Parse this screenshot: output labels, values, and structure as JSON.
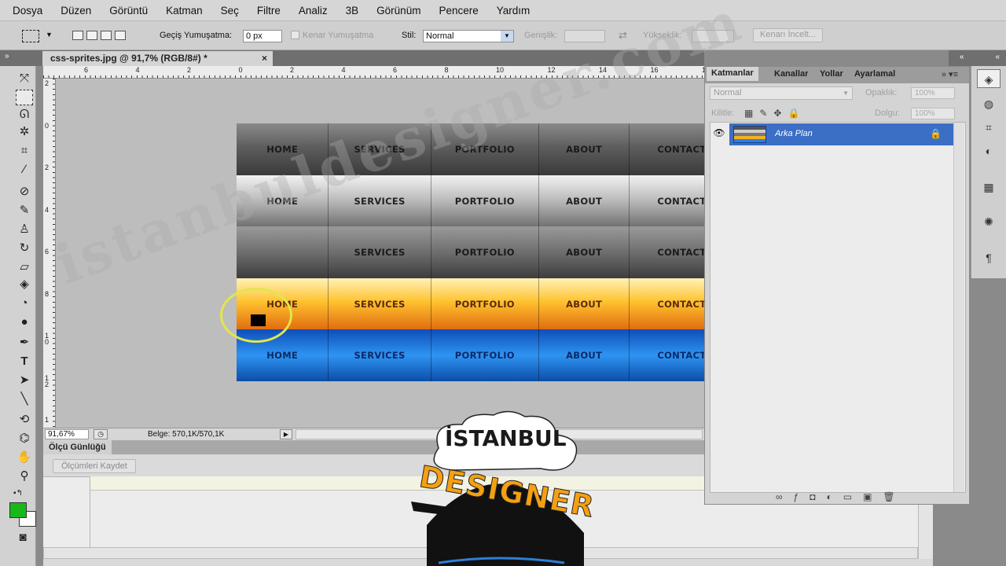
{
  "menu": [
    "Dosya",
    "Düzen",
    "Görüntü",
    "Katman",
    "Seç",
    "Filtre",
    "Analiz",
    "3B",
    "Görünüm",
    "Pencere",
    "Yardım"
  ],
  "options": {
    "feather_label": "Geçiş Yumuşatma:",
    "feather_value": "0 px",
    "antialias_label": "Kenar Yumuşatma",
    "style_label": "Stil:",
    "style_value": "Normal",
    "width_label": "Genişlik:",
    "height_label": "Yükseklik:",
    "refine_label": "Kenarı İncelt..."
  },
  "document_tab": {
    "title": "css-sprites.jpg @ 91,7% (RGB/8#) *",
    "close": "×"
  },
  "ruler_h_labels": [
    "6",
    "4",
    "2",
    "0",
    "2",
    "4",
    "6",
    "8",
    "10",
    "12",
    "14",
    "16",
    "1"
  ],
  "ruler_v_labels": [
    "2",
    "0",
    "2",
    "4",
    "6",
    "8",
    "1\n0",
    "1\n2",
    "1"
  ],
  "sprite_rows": [
    [
      "HOME",
      "SERVICES",
      "PORTFOLIO",
      "ABOUT",
      "CONTACT"
    ],
    [
      "HOME",
      "SERVICES",
      "PORTFOLIO",
      "ABOUT",
      "CONTACT"
    ],
    [
      "",
      "SERVICES",
      "PORTFOLIO",
      "ABOUT",
      "CONTACT"
    ],
    [
      "HOME",
      "SERVICES",
      "PORTFOLIO",
      "ABOUT",
      "CONTACT"
    ],
    [
      "HOME",
      "SERVICES",
      "PORTFOLIO",
      "ABOUT",
      "CONTACT"
    ]
  ],
  "status": {
    "zoom": "91,67%",
    "doc_info": "Belge: 570,1K/570,1K"
  },
  "measurement_log": {
    "tab_label": "Ölçü Günlüğü",
    "record_button": "Ölçümleri Kaydet"
  },
  "layers_panel": {
    "tabs": [
      "Katmanlar",
      "Kanallar",
      "Yollar",
      "Ayarlamal"
    ],
    "blend_mode": "Normal",
    "opacity_label": "Opaklık:",
    "opacity_value": "100%",
    "lock_label": "Kilitle:",
    "fill_label": "Dolgu:",
    "fill_value": "100%",
    "layer_name": "Arka Plan"
  },
  "colors": {
    "foreground": "#18b818",
    "background": "#ffffff",
    "layer_selected": "#3b6fc6"
  },
  "watermark": "istanbuldesigner.com",
  "logo": {
    "line1": "İSTANBUL",
    "line2": "DESIGNER"
  }
}
